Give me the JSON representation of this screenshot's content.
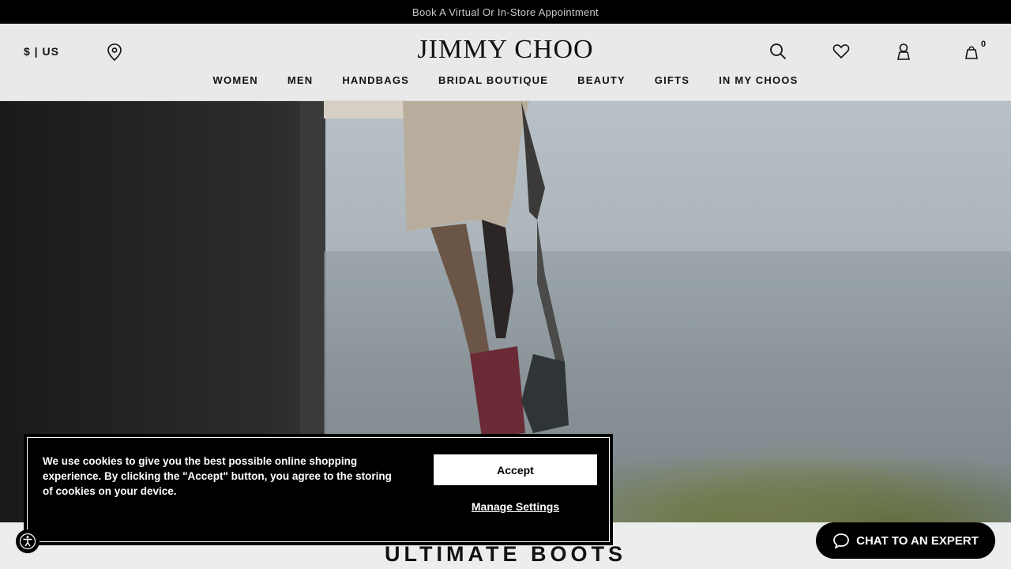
{
  "announcement": {
    "text": "Book A Virtual Or In-Store Appointment"
  },
  "header": {
    "currency_label": "$ | US",
    "logo": "JIMMY CHOO",
    "cart_count": "0",
    "icons": [
      "store-locator-icon",
      "search-icon",
      "heart-icon",
      "account-icon",
      "bag-icon"
    ]
  },
  "nav": {
    "items": [
      {
        "label": "WOMEN"
      },
      {
        "label": "MEN"
      },
      {
        "label": "HANDBAGS"
      },
      {
        "label": "BRIDAL BOUTIQUE"
      },
      {
        "label": "BEAUTY"
      },
      {
        "label": "GIFTS"
      },
      {
        "label": "IN MY CHOOS"
      }
    ]
  },
  "cookie_banner": {
    "message": "We use cookies to give you the best possible online shopping experience. By clicking the \"Accept\" button, you agree to the storing of cookies on your device.",
    "accept_label": "Accept",
    "manage_label": "Manage Settings"
  },
  "section": {
    "title": "ULTIMATE BOOTS"
  },
  "chat": {
    "label": "CHAT TO AN EXPERT",
    "icon": "chat-bubble-icon"
  },
  "accessibility": {
    "icon": "accessibility-icon"
  },
  "colors": {
    "announcement_bg": "#000000",
    "header_bg": "#e9e9e9",
    "banner_bg": "#000000",
    "chat_bg": "#000000"
  }
}
